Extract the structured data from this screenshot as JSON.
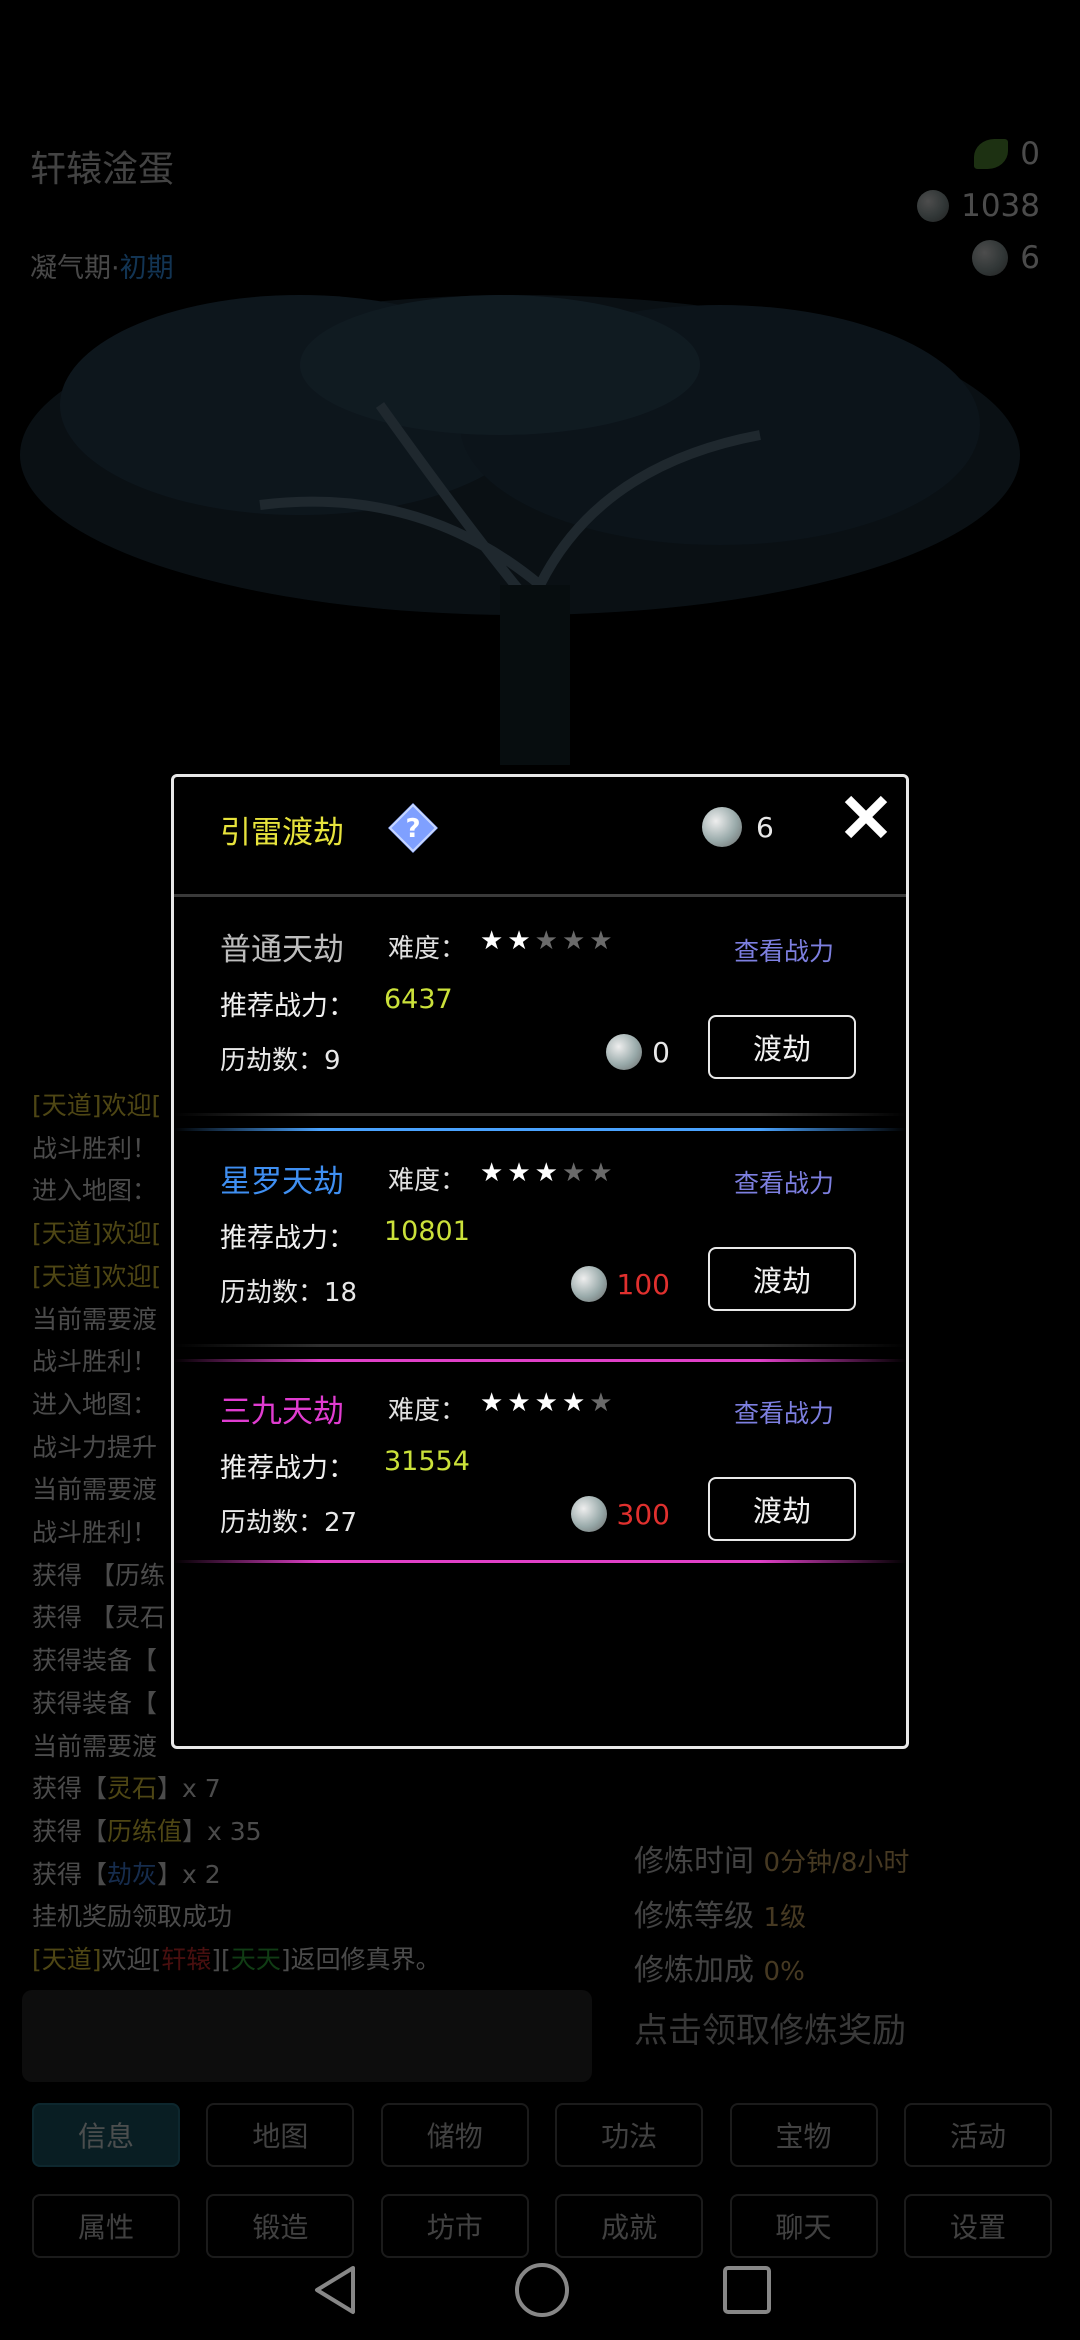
{
  "background": {
    "player_name": "轩辕淦蛋",
    "realm": "凝气期·",
    "realm_stage": "初期",
    "currencies": [
      {
        "icon": "leaf-icon",
        "value": "0"
      },
      {
        "icon": "spirit-stone-icon",
        "value": "1038"
      },
      {
        "icon": "orb-icon",
        "value": "6"
      }
    ],
    "log_lines": [
      {
        "parts": [
          [
            "t",
            "[天道]欢迎["
          ]
        ]
      },
      {
        "parts": [
          [
            "",
            "战斗胜利！"
          ]
        ]
      },
      {
        "parts": [
          [
            "",
            "进入地图："
          ]
        ]
      },
      {
        "parts": [
          [
            "t",
            "[天道]欢迎["
          ]
        ]
      },
      {
        "parts": [
          [
            "t",
            "[天道]欢迎["
          ]
        ]
      },
      {
        "parts": [
          [
            "",
            "当前需要渡"
          ]
        ]
      },
      {
        "parts": [
          [
            "",
            "战斗胜利！"
          ]
        ]
      },
      {
        "parts": [
          [
            "",
            "进入地图："
          ]
        ]
      },
      {
        "parts": [
          [
            "",
            "战斗力提升"
          ]
        ]
      },
      {
        "parts": [
          [
            "",
            "当前需要渡"
          ]
        ]
      },
      {
        "parts": [
          [
            "",
            "战斗胜利！"
          ]
        ]
      },
      {
        "parts": [
          [
            "",
            "获得 【历练"
          ]
        ]
      },
      {
        "parts": [
          [
            "",
            "获得 【灵石"
          ]
        ]
      },
      {
        "parts": [
          [
            "",
            "获得装备【"
          ]
        ]
      },
      {
        "parts": [
          [
            "",
            "获得装备【"
          ]
        ]
      },
      {
        "parts": [
          [
            "",
            "当前需要渡"
          ]
        ]
      },
      {
        "parts": [
          [
            "",
            "获得【"
          ],
          [
            "t",
            "灵石"
          ],
          [
            "",
            "】x 7"
          ]
        ]
      },
      {
        "parts": [
          [
            "",
            "获得【"
          ],
          [
            "t",
            "历练值"
          ],
          [
            "",
            "】x 35"
          ]
        ]
      },
      {
        "parts": [
          [
            "",
            "获得【"
          ],
          [
            "b",
            "劫灰"
          ],
          [
            "",
            "】x 2"
          ]
        ]
      },
      {
        "parts": [
          [
            "",
            "挂机奖励领取成功"
          ]
        ]
      },
      {
        "parts": [
          [
            "t",
            "[天道]"
          ],
          [
            "",
            "欢迎["
          ],
          [
            "r",
            "轩辕"
          ],
          [
            "",
            "]["
          ],
          [
            "g",
            "天天"
          ],
          [
            "",
            "]返回修真界。"
          ]
        ]
      }
    ],
    "cultivation": [
      {
        "label": "修炼时间",
        "value": "0分钟/8小时"
      },
      {
        "label": "修炼等级",
        "value": "1级"
      },
      {
        "label": "修炼加成",
        "value": "0%"
      }
    ],
    "claim_text": "点击领取修炼奖励",
    "tabs_row1": [
      "信息",
      "地图",
      "储物",
      "功法",
      "宝物",
      "活动"
    ],
    "tabs_row2": [
      "属性",
      "锻造",
      "坊市",
      "成就",
      "聊天",
      "设置"
    ],
    "active_tab": "信息"
  },
  "modal": {
    "title": "引雷渡劫",
    "currency_value": "6",
    "diff_label": "难度：",
    "rec_label": "推荐战力：",
    "count_label": "历劫数：",
    "view_label": "查看战力",
    "button_label": "渡劫",
    "tribulations": [
      {
        "name": "普通天劫",
        "name_color": "#bdbdbd",
        "stars": 2,
        "power": "6437",
        "count": "9",
        "cost": "0",
        "cost_color": "#e8e8e8",
        "sep_color": "#4aa3ff"
      },
      {
        "name": "星罗天劫",
        "name_color": "#3f8ff2",
        "stars": 3,
        "power": "10801",
        "count": "18",
        "cost": "100",
        "cost_color": "#e0302e",
        "sep_color": "#e040c8"
      },
      {
        "name": "三九天劫",
        "name_color": "#e03cd0",
        "stars": 4,
        "power": "31554",
        "count": "27",
        "cost": "300",
        "cost_color": "#e0302e",
        "sep_color": "#e040c8"
      }
    ],
    "max_stars": 5
  }
}
